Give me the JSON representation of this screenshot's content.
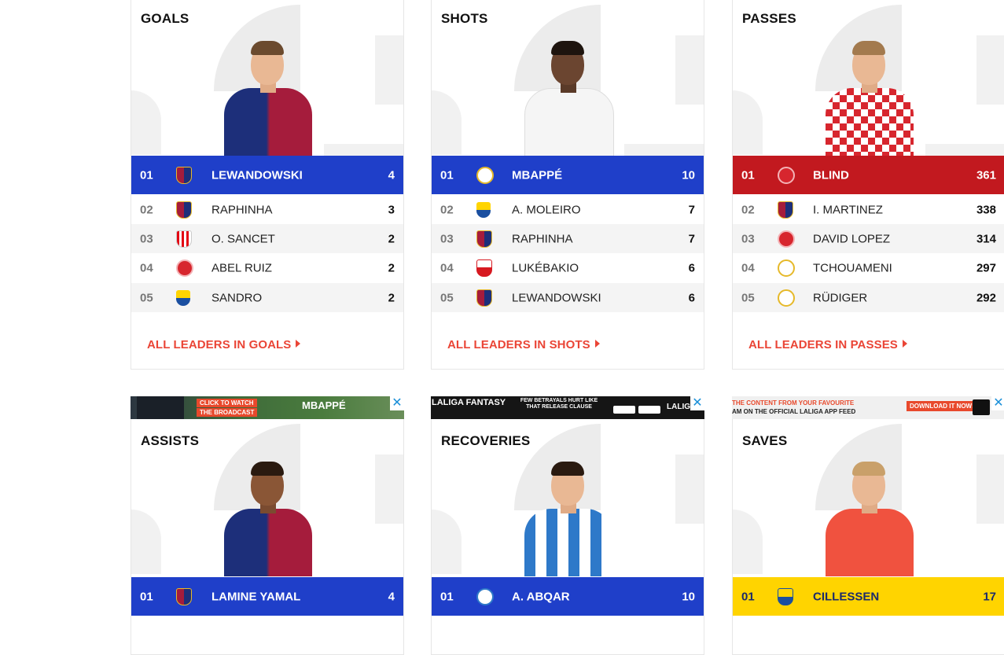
{
  "colors": {
    "laliga_blue": "#1f3fc9",
    "girona_red": "#c2191f",
    "laspalmas_yellow": "#ffd400",
    "link_red": "#ea4536"
  },
  "cards": [
    {
      "title": "GOALS",
      "leader": {
        "rank": "01",
        "crest": "barcelona-crest",
        "name": "LEWANDOWSKI",
        "value": "4",
        "color": "#1f3fc9"
      },
      "rows": [
        {
          "rank": "02",
          "crest": "barcelona-crest",
          "name": "RAPHINHA",
          "value": "3"
        },
        {
          "rank": "03",
          "crest": "athletic-crest",
          "name": "O. SANCET",
          "value": "2"
        },
        {
          "rank": "04",
          "crest": "girona-crest",
          "name": "ABEL RUIZ",
          "value": "2"
        },
        {
          "rank": "05",
          "crest": "laspalmas-crest",
          "name": "SANDRO",
          "value": "2"
        }
      ],
      "link": "ALL LEADERS IN GOALS"
    },
    {
      "title": "SHOTS",
      "leader": {
        "rank": "01",
        "crest": "realmadrid-crest",
        "name": "MBAPPÉ",
        "value": "10",
        "color": "#1f3fc9"
      },
      "rows": [
        {
          "rank": "02",
          "crest": "laspalmas-crest",
          "name": "A. MOLEIRO",
          "value": "7"
        },
        {
          "rank": "03",
          "crest": "barcelona-crest",
          "name": "RAPHINHA",
          "value": "7"
        },
        {
          "rank": "04",
          "crest": "sevilla-crest",
          "name": "LUKÉBAKIO",
          "value": "6"
        },
        {
          "rank": "05",
          "crest": "barcelona-crest",
          "name": "LEWANDOWSKI",
          "value": "6"
        }
      ],
      "link": "ALL LEADERS IN SHOTS"
    },
    {
      "title": "PASSES",
      "leader": {
        "rank": "01",
        "crest": "girona-crest",
        "name": "BLIND",
        "value": "361",
        "color": "#c2191f"
      },
      "rows": [
        {
          "rank": "02",
          "crest": "barcelona-crest",
          "name": "I. MARTINEZ",
          "value": "338"
        },
        {
          "rank": "03",
          "crest": "girona-crest",
          "name": "DAVID LOPEZ",
          "value": "314"
        },
        {
          "rank": "04",
          "crest": "realmadrid-crest",
          "name": "TCHOUAMENI",
          "value": "297"
        },
        {
          "rank": "05",
          "crest": "realmadrid-crest",
          "name": "RÜDIGER",
          "value": "292"
        }
      ],
      "link": "ALL LEADERS IN PASSES"
    },
    {
      "title": "ASSISTS",
      "leader": {
        "rank": "01",
        "crest": "barcelona-crest",
        "name": "LAMINE YAMAL",
        "value": "4",
        "color": "#1f3fc9"
      }
    },
    {
      "title": "RECOVERIES",
      "leader": {
        "rank": "01",
        "crest": "alaves-crest",
        "name": "A. ABQAR",
        "value": "10",
        "color": "#1f3fc9"
      }
    },
    {
      "title": "SAVES",
      "leader": {
        "rank": "01",
        "crest": "laspalmas-crest",
        "name": "CILLESSEN",
        "value": "17",
        "color": "#ffd400"
      }
    }
  ],
  "ads": [
    {
      "text_a": "CLICK TO WATCH",
      "text_b": "THE BROADCAST",
      "text_c": "MBAPPÉ",
      "close": "✕"
    },
    {
      "text_a": "LALIGA",
      "text_b": "FANTASY",
      "text_c": "FEW BETRAYALS HURT LIKE THAT RELEASE CLAUSE",
      "text_d": "LALIGA",
      "close": "✕"
    },
    {
      "text_a": "THE CONTENT FROM YOUR FAVOURITE",
      "text_b": "AM ON THE OFFICIAL LALIGA APP FEED",
      "text_c": "DOWNLOAD IT NOW!",
      "close": "✕"
    }
  ]
}
